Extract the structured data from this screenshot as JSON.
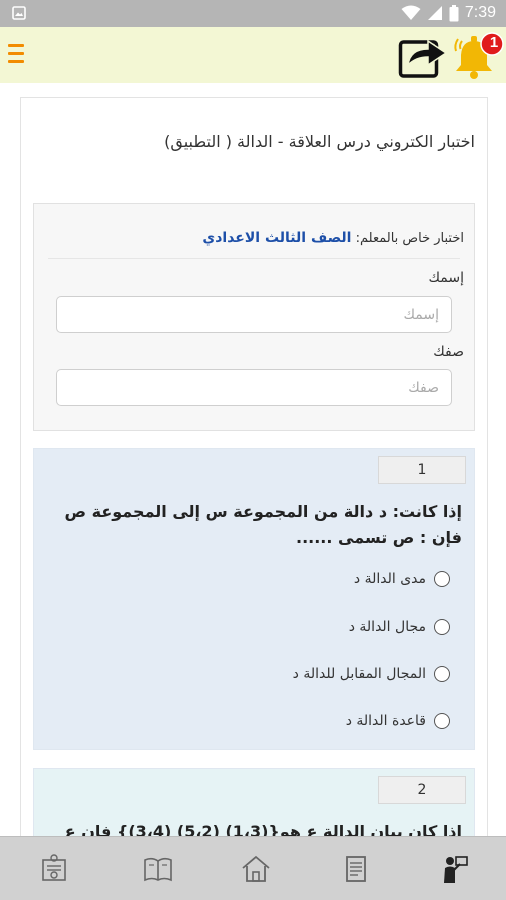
{
  "status_bar": {
    "time": "7:39"
  },
  "app_bar": {
    "notification_count": "1"
  },
  "exam": {
    "title": "اختبار الكتروني درس العلاقة - الدالة ( التطبيق)",
    "teacher_prefix": "اختبار خاص بالمعلم:",
    "grade": "الصف الثالث الاعدادي",
    "name_label": "إسمك",
    "name_placeholder": "إسمك",
    "class_label": "صفك",
    "class_placeholder": "صفك"
  },
  "questions": [
    {
      "number": "1",
      "text": "إذا كانت: د دالة من المجموعة س إلى المجموعة ص فإن : ص تسمى ......",
      "options": [
        "مدى الدالة د",
        "مجال الدالة د",
        "المجال المقابل للدالة د",
        "قاعدة الدالة د"
      ]
    },
    {
      "number": "2",
      "text": "إذا كان بيان الدالة ع هو{(1،3) (5،2) (3،4)} فإن ع"
    }
  ],
  "colors": {
    "accent_orange": "#f28c00",
    "app_bar_bg": "#f3f7d4",
    "grade_blue": "#1d4fa8",
    "question_bg": "#e4ecf5"
  },
  "bottom_nav": [
    "certificate-icon",
    "book-icon",
    "home-icon",
    "document-icon",
    "teacher-icon"
  ]
}
